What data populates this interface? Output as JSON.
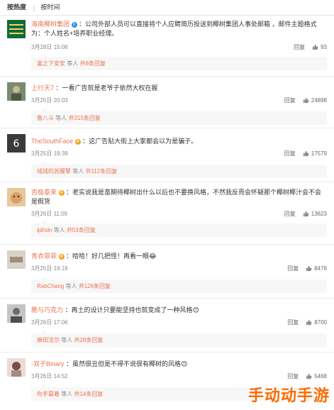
{
  "tabs": {
    "hot": "按热度",
    "time": "按时间"
  },
  "actions": {
    "reply": "回复"
  },
  "comments": [
    {
      "user": "海南椰树集团",
      "text": "：公司外部人员可以直接将个人应聘简历投送到椰树集团人事处邮箱 ，邮件主题格式为：个人姓名+培养职业经理。",
      "date": "3月28日 15:08",
      "likes": "93",
      "sub_user": "富之下安安",
      "sub_mid": " 等人 ",
      "sub_count": "共8条回复"
    },
    {
      "user": "上行天7",
      "text": "：一看广告就是老爷子依然大权在握",
      "date": "3月25日 20:03",
      "likes": "24898",
      "sub_user": "鲁八斗",
      "sub_mid": " 等人 ",
      "sub_count": "共315条回复"
    },
    {
      "user": "TheSouthFace",
      "text": "：这广告贴大街上大家都会以为是骗子。",
      "date": "3月25日 19:39",
      "likes": "17579",
      "sub_user": "绒绒的苏醒擎",
      "sub_mid": " 等人 ",
      "sub_count": "共112条回复"
    },
    {
      "user": "否极泰来",
      "text": "：老实说我是蛮期待椰树出什么以后也不要换风格，不然我反而会怀疑那个椰树椰汁会不会是假货",
      "date": "3月26日 11:09",
      "likes": "13623",
      "sub_user": "ijdhdn",
      "sub_mid": " 等人 ",
      "sub_count": "共53条回复"
    },
    {
      "user": "青衣菲菲",
      "text": "：哈哈！好几把怪！再看一眼😂",
      "date": "3月25日 19:19",
      "likes": "8476",
      "sub_user": "RabChang",
      "sub_mid": " 等人 ",
      "sub_count": "共126条回复"
    },
    {
      "user": "脆与巧克力",
      "text": "：再土的设计只要能坚持也就变成了一种风格😊",
      "date": "3月26日 17:06",
      "likes": "8700",
      "sub_user": "麻田淦尔",
      "sub_mid": " 等人 ",
      "sub_count": "共28条回复"
    },
    {
      "user": "-双子Binary",
      "text": "：虽然很丑但是不得不说很有椰树的风格😊",
      "date": "3月26日 14:52",
      "likes": "5468",
      "sub_user": "你手篡着",
      "sub_mid": " 等人 ",
      "sub_count": "共14条回复"
    }
  ],
  "watermark": "手动动手游"
}
